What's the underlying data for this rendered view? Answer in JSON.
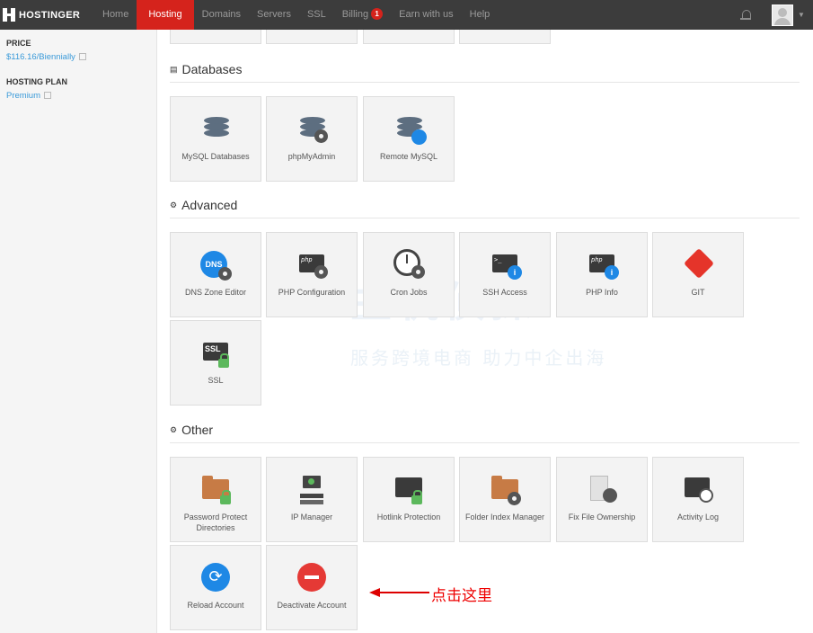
{
  "nav": {
    "brand": "HOSTINGER",
    "items": [
      {
        "label": "Home"
      },
      {
        "label": "Hosting",
        "active": true
      },
      {
        "label": "Domains"
      },
      {
        "label": "Servers"
      },
      {
        "label": "SSL"
      },
      {
        "label": "Billing",
        "badge": "1"
      },
      {
        "label": "Earn with us"
      },
      {
        "label": "Help"
      }
    ]
  },
  "sidebar": {
    "price_label": "PRICE",
    "price_value": "$116.16/Biennially",
    "plan_label": "HOSTING PLAN",
    "plan_value": "Premium"
  },
  "sections": {
    "databases": {
      "title": "Databases",
      "tiles": [
        {
          "label": "MySQL Databases",
          "icon": "database-icon"
        },
        {
          "label": "phpMyAdmin",
          "icon": "database-gear-icon"
        },
        {
          "label": "Remote MySQL",
          "icon": "database-wifi-icon"
        }
      ]
    },
    "advanced": {
      "title": "Advanced",
      "tiles": [
        {
          "label": "DNS Zone Editor",
          "icon": "dns-globe-icon"
        },
        {
          "label": "PHP Configuration",
          "icon": "php-gear-icon"
        },
        {
          "label": "Cron Jobs",
          "icon": "clock-gear-icon"
        },
        {
          "label": "SSH Access",
          "icon": "terminal-icon"
        },
        {
          "label": "PHP Info",
          "icon": "php-info-icon"
        },
        {
          "label": "GIT",
          "icon": "git-icon"
        },
        {
          "label": "SSL",
          "icon": "ssl-lock-icon"
        }
      ]
    },
    "other": {
      "title": "Other",
      "tiles": [
        {
          "label": "Password Protect Directories",
          "icon": "folder-lock-icon"
        },
        {
          "label": "IP Manager",
          "icon": "ip-manager-icon"
        },
        {
          "label": "Hotlink Protection",
          "icon": "hotlink-icon"
        },
        {
          "label": "Folder Index Manager",
          "icon": "folder-gear-icon"
        },
        {
          "label": "Fix File Ownership",
          "icon": "file-user-icon"
        },
        {
          "label": "Activity Log",
          "icon": "activity-log-icon"
        },
        {
          "label": "Reload Account",
          "icon": "reload-icon"
        },
        {
          "label": "Deactivate Account",
          "icon": "deactivate-icon"
        }
      ]
    }
  },
  "annotation": {
    "text": "点击这里"
  },
  "watermark": {
    "line1": "主机侦探",
    "line2": "服务跨境电商 助力中企出海"
  },
  "colors": {
    "brand_red": "#d5231c",
    "link_blue": "#3a9ad9",
    "nav_bg": "#3c3c3c"
  }
}
